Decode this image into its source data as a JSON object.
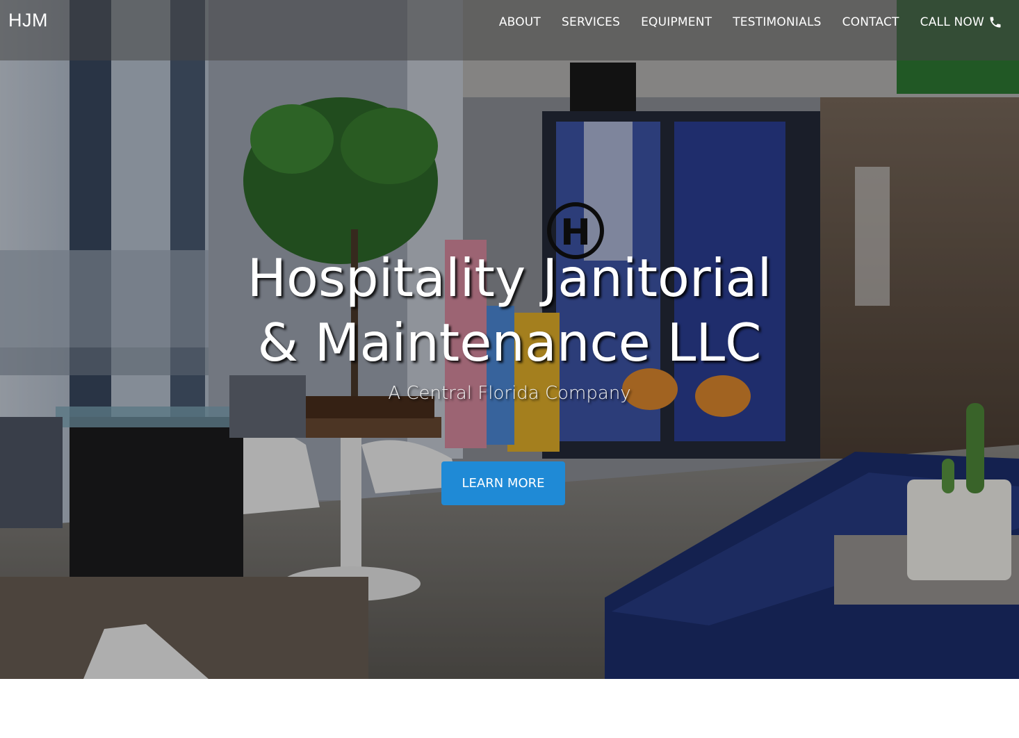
{
  "navbar": {
    "brand": "HJM",
    "links": [
      {
        "label": "ABOUT"
      },
      {
        "label": "SERVICES"
      },
      {
        "label": "EQUIPMENT"
      },
      {
        "label": "TESTIMONIALS"
      },
      {
        "label": "CONTACT"
      }
    ],
    "call_now": {
      "label": "CALL NOW",
      "icon": "phone-icon"
    }
  },
  "hero": {
    "title_line1": "Hospitality Janitorial",
    "title_line2": "& Maintenance LLC",
    "subtitle": "A Central Florida Company",
    "cta_label": "LEARN MORE",
    "background": "office-lounge-photo"
  },
  "colors": {
    "cta_background": "#1f8ad6",
    "navbar_background": "rgba(70,70,70,0.55)",
    "text": "#ffffff"
  }
}
